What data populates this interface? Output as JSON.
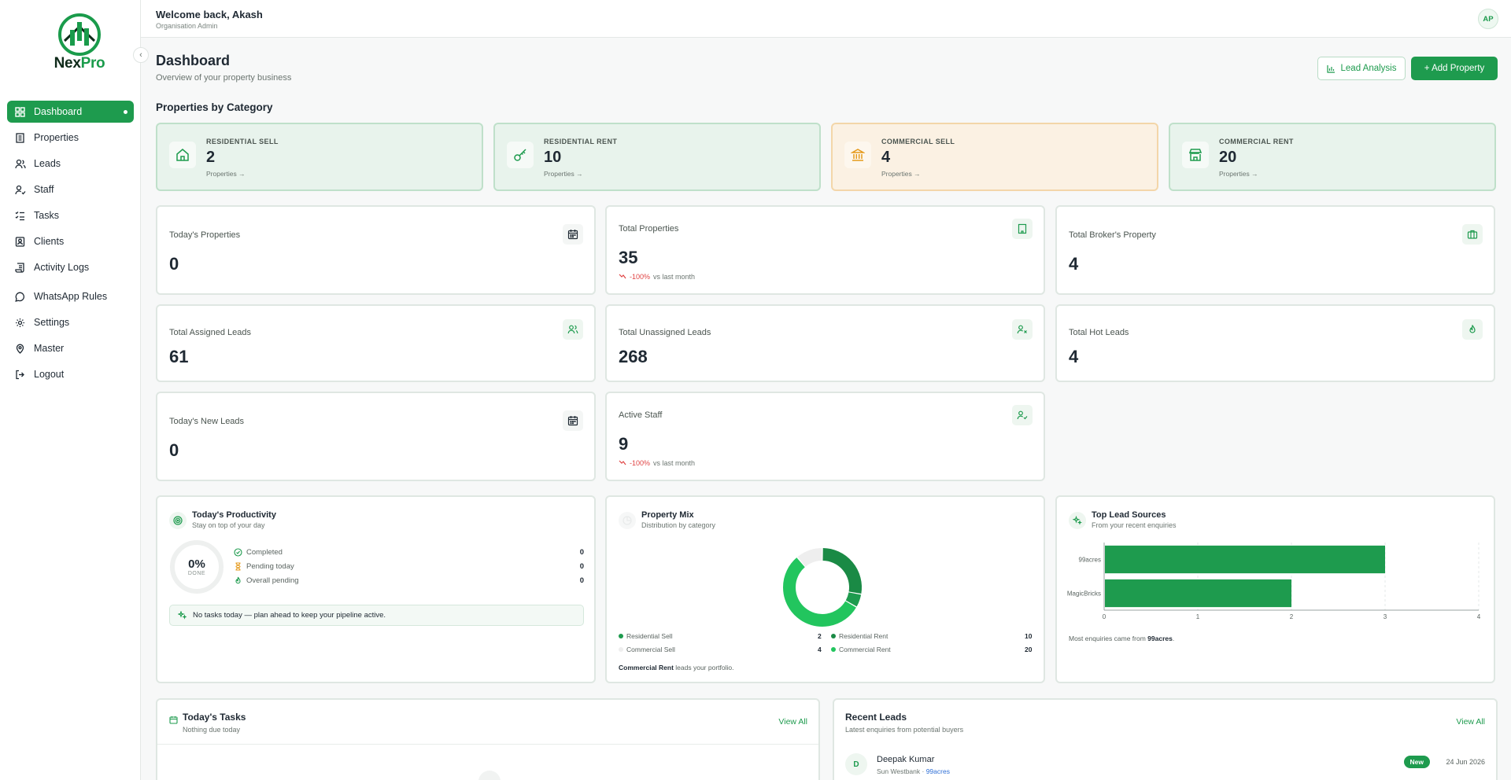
{
  "brand": {
    "name_a": "Nex",
    "name_b": "Pro"
  },
  "sidebar": {
    "items": [
      {
        "label": "Dashboard",
        "icon": "dashboard-icon",
        "active": true
      },
      {
        "label": "Properties",
        "icon": "building-icon"
      },
      {
        "label": "Leads",
        "icon": "users-icon"
      },
      {
        "label": "Staff",
        "icon": "user-check-icon"
      },
      {
        "label": "Tasks",
        "icon": "list-checks-icon"
      },
      {
        "label": "Clients",
        "icon": "contact-icon"
      },
      {
        "label": "Activity Logs",
        "icon": "scroll-icon"
      },
      {
        "label": "WhatsApp Rules",
        "icon": "message-icon"
      },
      {
        "label": "Settings",
        "icon": "gear-icon"
      },
      {
        "label": "Master",
        "icon": "map-pin-icon"
      },
      {
        "label": "Logout",
        "icon": "logout-icon"
      }
    ]
  },
  "header": {
    "welcome": "Welcome back, Akash",
    "role": "Organisation Admin",
    "avatar": "AP"
  },
  "page": {
    "title": "Dashboard",
    "subtitle": "Overview of your property business"
  },
  "actions": {
    "lead_analysis": "Lead Analysis",
    "add_property": "+ Add Property"
  },
  "categories": {
    "title": "Properties by Category",
    "items": [
      {
        "label": "RESIDENTIAL SELL",
        "value": "2",
        "link": "Properties →"
      },
      {
        "label": "RESIDENTIAL RENT",
        "value": "10",
        "link": "Properties →"
      },
      {
        "label": "COMMERCIAL SELL",
        "value": "4",
        "link": "Properties →"
      },
      {
        "label": "COMMERCIAL RENT",
        "value": "20",
        "link": "Properties →"
      }
    ]
  },
  "stats": {
    "todays_properties": {
      "label": "Today's Properties",
      "value": "0"
    },
    "total_properties": {
      "label": "Total Properties",
      "value": "35",
      "trend": "-100%",
      "trend_note": "vs last month"
    },
    "total_brokers": {
      "label": "Total Broker's Property",
      "value": "4"
    },
    "assigned_leads": {
      "label": "Total Assigned Leads",
      "value": "61"
    },
    "unassigned_leads": {
      "label": "Total Unassigned Leads",
      "value": "268"
    },
    "hot_leads": {
      "label": "Total Hot Leads",
      "value": "4"
    },
    "new_leads": {
      "label": "Today's New Leads",
      "value": "0"
    },
    "active_staff": {
      "label": "Active Staff",
      "value": "9",
      "trend": "-100%",
      "trend_note": "vs last month"
    }
  },
  "productivity": {
    "title": "Today's Productivity",
    "subtitle": "Stay on top of your day",
    "percent": "0%",
    "done_label": "DONE",
    "rows": [
      {
        "label": "Completed",
        "value": "0"
      },
      {
        "label": "Pending today",
        "value": "0"
      },
      {
        "label": "Overall pending",
        "value": "0"
      }
    ],
    "note": "No tasks today — plan ahead to keep your pipeline active."
  },
  "property_mix": {
    "title": "Property Mix",
    "subtitle": "Distribution by category",
    "legend": [
      {
        "label": "Residential Sell",
        "value": "2",
        "color": "#1e9b4e"
      },
      {
        "label": "Residential Rent",
        "value": "10",
        "color": "#1a8a45"
      },
      {
        "label": "Commercial Sell",
        "value": "4",
        "color": "#eeeeee"
      },
      {
        "label": "Commercial Rent",
        "value": "20",
        "color": "#22c55e"
      }
    ],
    "note_bold": "Commercial Rent",
    "note_rest": " leads your portfolio."
  },
  "lead_sources": {
    "title": "Top Lead Sources",
    "subtitle": "From your recent enquiries",
    "note_pre": "Most enquiries came from ",
    "note_bold": "99acres",
    "note_post": "."
  },
  "chart_data": {
    "type": "bar",
    "orientation": "horizontal",
    "categories": [
      "99acres",
      "MagicBricks"
    ],
    "values": [
      3,
      2
    ],
    "x_ticks": [
      "0",
      "1",
      "2",
      "3",
      "4"
    ],
    "xlim": [
      0,
      4
    ],
    "color": "#1e9b4e",
    "grid": true
  },
  "tasks": {
    "title": "Today's Tasks",
    "subtitle": "Nothing due today",
    "view_all": "View All"
  },
  "recent_leads": {
    "title": "Recent Leads",
    "subtitle": "Latest enquiries from potential buyers",
    "view_all": "View All",
    "items": [
      {
        "initial": "D",
        "name": "Deepak Kumar",
        "project": "Sun Westbank",
        "source": "99acres",
        "badge": "New",
        "date": "24 Jun 2026"
      }
    ]
  }
}
